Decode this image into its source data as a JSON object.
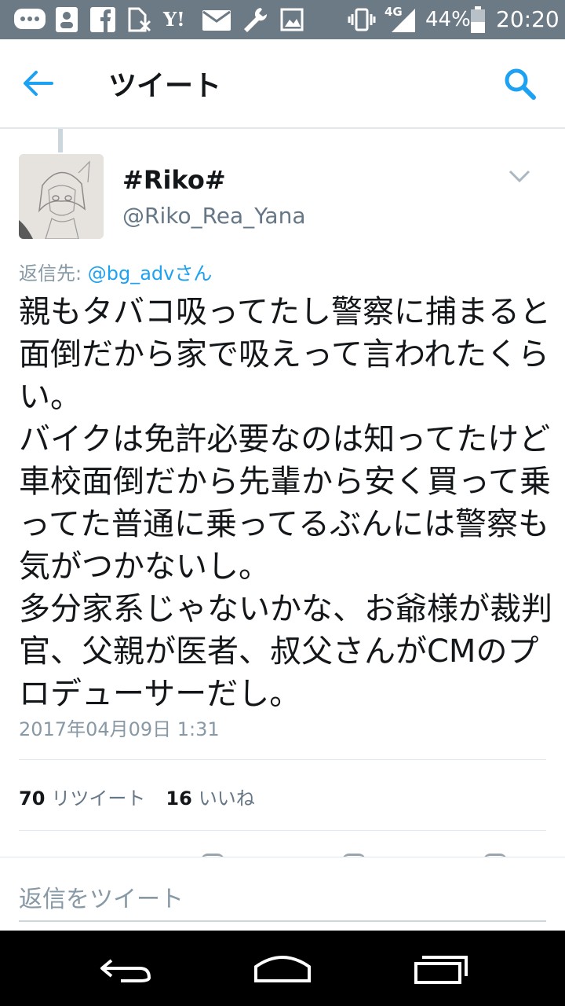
{
  "status_bar": {
    "network": "4G",
    "battery": "44%",
    "time": "20:20",
    "icons": [
      "message-icon",
      "contacts-icon",
      "facebook-icon",
      "no-sim-icon",
      "yahoo-icon",
      "au-mail-icon",
      "wrench-icon",
      "image-icon",
      "vibrate-icon",
      "signal-icon",
      "battery-icon"
    ],
    "yahoo_label": "Y!"
  },
  "app_bar": {
    "title": "ツイート",
    "back_icon": "arrow-left-icon",
    "search_icon": "search-icon"
  },
  "tweet": {
    "display_name": "#Riko#",
    "handle": "@Riko_Rea_Yana",
    "reply_prefix": "返信先:",
    "reply_mention": "@bg_adv",
    "reply_suffix": "さん",
    "text": "親もタバコ吸ってたし警察に捕まると面倒だから家で吸えって言われたくらい。\nバイクは免許必要なのは知ってたけど車校面倒だから先輩から安く買って乗ってた普通に乗ってるぶんには警察も気がつかないし。\n多分家系じゃないかな、お爺様が裁判官、父親が医者、叔父さんがCMのプロデューサーだし。",
    "timestamp": "2017年04月09日 1:31",
    "retweets_count": "70",
    "retweets_label": "リツイート",
    "likes_count": "16",
    "likes_label": "いいね"
  },
  "reply_box": {
    "placeholder": "返信をツイート"
  },
  "colors": {
    "accent": "#1da1f2",
    "status_bar": "#6b7a85",
    "secondary_text": "#8899a6"
  }
}
